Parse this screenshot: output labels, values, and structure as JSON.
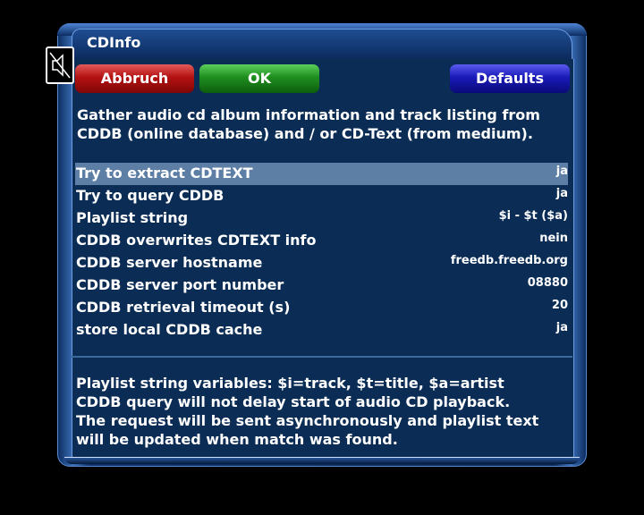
{
  "window": {
    "title": "CDInfo"
  },
  "buttons": {
    "cancel": "Abbruch",
    "ok": "OK",
    "defaults": "Defaults"
  },
  "colors": {
    "red": "#b41212",
    "green": "#1f8e1f",
    "blue": "#1a1ab8",
    "panel": "#0b2d55",
    "selection": "#5d7ea5"
  },
  "description": {
    "line1": "Gather audio cd album information and track listing from",
    "line2": "CDDB (online database) and / or CD-Text (from medium)."
  },
  "settings": [
    {
      "label": "Try to extract CDTEXT",
      "value": "ja",
      "selected": true
    },
    {
      "label": "Try to query CDDB",
      "value": "ja"
    },
    {
      "label": "Playlist string",
      "value": "$i - $t ($a)"
    },
    {
      "label": "CDDB overwrites CDTEXT info",
      "value": "nein"
    },
    {
      "label": "CDDB server hostname",
      "value": "freedb.freedb.org"
    },
    {
      "label": "CDDB server port number",
      "value": "08880"
    },
    {
      "label": "CDDB retrieval timeout (s)",
      "value": "20"
    },
    {
      "label": "store local CDDB cache",
      "value": "ja"
    }
  ],
  "help": {
    "line1": "Playlist string variables: $i=track, $t=title, $a=artist",
    "line2": "CDDB query will not delay start of audio CD playback.",
    "line3": "The request will be sent asynchronously and playlist text",
    "line4": "will be updated when match was found."
  },
  "icons": {
    "mute": "mute-icon"
  }
}
